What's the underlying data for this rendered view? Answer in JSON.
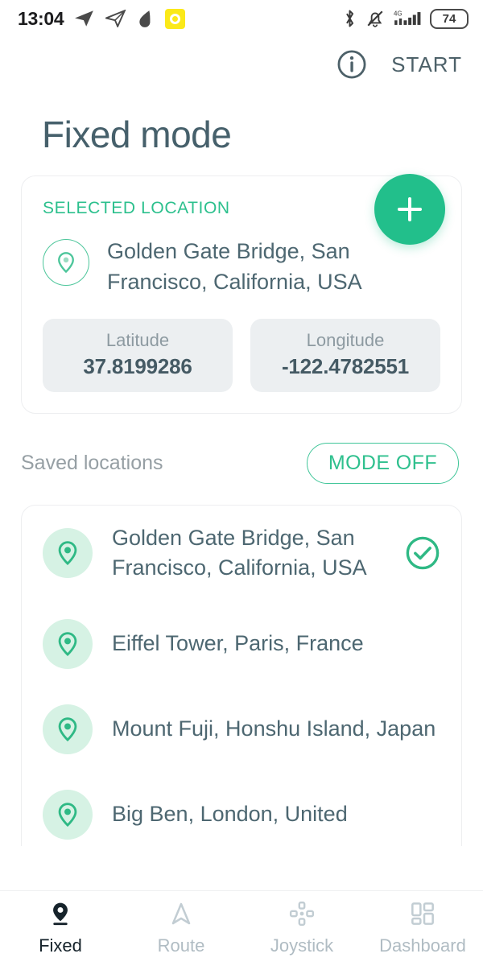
{
  "statusbar": {
    "time": "13:04",
    "icons_left": [
      "telegram-send-icon",
      "send-outline-icon",
      "ink-drop-icon",
      "yellow-recorder-icon"
    ],
    "icons_right": [
      "bluetooth-icon",
      "bell-muted-icon",
      "signal-4g-icon"
    ],
    "network": "4G",
    "battery": "74"
  },
  "appbar": {
    "info_icon": "info-circle-icon",
    "start_label": "START"
  },
  "page": {
    "title": "Fixed mode"
  },
  "fab": {
    "icon": "plus-icon",
    "color": "#22BF8B"
  },
  "selected": {
    "label": "SELECTED LOCATION",
    "pin_icon": "map-pin-icon",
    "address": "Golden Gate Bridge, San Francisco, California, USA",
    "latitude_label": "Latitude",
    "latitude_value": "37.8199286",
    "longitude_label": "Longitude",
    "longitude_value": "-122.4782551"
  },
  "saved": {
    "title": "Saved locations",
    "mode_button": "MODE OFF",
    "items": [
      {
        "name": "Golden Gate Bridge, San Francisco, California, USA",
        "icon": "map-pin-icon",
        "selected": true,
        "check_icon": "check-circle-icon"
      },
      {
        "name": "Eiffel Tower, Paris, France",
        "icon": "map-pin-icon",
        "selected": false
      },
      {
        "name": "Mount Fuji, Honshu Island, Japan",
        "icon": "map-pin-icon",
        "selected": false
      },
      {
        "name": "Big Ben, London, United",
        "icon": "map-pin-icon",
        "selected": false
      }
    ]
  },
  "bottomnav": {
    "items": [
      {
        "label": "Fixed",
        "icon": "map-pin-filled-icon",
        "active": true
      },
      {
        "label": "Route",
        "icon": "navigation-arrow-icon",
        "active": false
      },
      {
        "label": "Joystick",
        "icon": "joystick-dpad-icon",
        "active": false
      },
      {
        "label": "Dashboard",
        "icon": "dashboard-grid-icon",
        "active": false
      }
    ]
  },
  "colors": {
    "accent_green": "#22BF8B",
    "text_dark": "#4D6771",
    "text_muted": "#969FA4",
    "chip_bg": "#ECEFF1"
  }
}
